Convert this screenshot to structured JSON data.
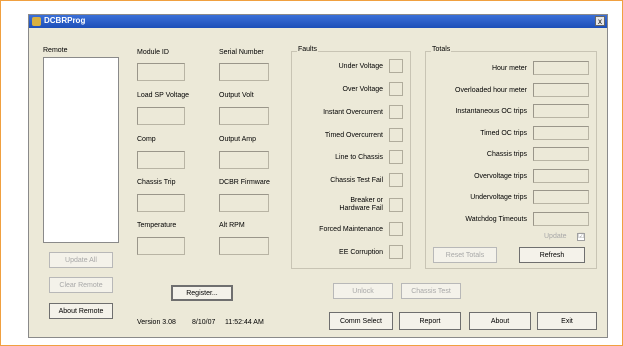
{
  "window": {
    "title": "DCBRProg",
    "close_glyph": "x"
  },
  "remote": {
    "label": "Remote",
    "buttons": {
      "update_all": "Update All",
      "clear_remote": "Clear Remote",
      "about_remote": "About Remote"
    }
  },
  "module": {
    "module_id": "Module ID",
    "serial_number": "Serial Number",
    "load_sp_voltage": "Load SP Voltage",
    "output_volt": "Output Volt",
    "comp": "Comp",
    "output_amp": "Output Amp",
    "chassis_trip": "Chassis Trip",
    "dcbr_firmware": "DCBR Firmware",
    "temperature": "Temperature",
    "alt_rpm": "Alt RPM"
  },
  "faults": {
    "title": "Faults",
    "items": [
      "Under Voltage",
      "Over Voltage",
      "Instant Overcurrent",
      "Timed Overcurrent",
      "Line to Chassis",
      "Chassis Test Fail",
      "Breaker or Hardware Fail",
      "Forced Maintenance",
      "EE Corruption"
    ]
  },
  "totals": {
    "title": "Totals",
    "items": [
      "Hour meter",
      "Overloaded hour meter",
      "Instantaneous OC trips",
      "Timed OC trips",
      "Chassis trips",
      "Overvoltage trips",
      "Undervoltage trips",
      "Watchdog Timeouts"
    ],
    "update_checkbox": "Update",
    "update_checked_glyph": "☑",
    "reset_totals": "Reset Totals",
    "refresh": "Refresh"
  },
  "bottom": {
    "register": "Register...",
    "unlock": "Unlock",
    "chassis_test": "Chassis Test",
    "version": "Version 3.08",
    "date": "8/10/07",
    "time": "11:52:44 AM",
    "comm_select": "Comm Select",
    "report": "Report",
    "about": "About",
    "exit": "Exit"
  }
}
